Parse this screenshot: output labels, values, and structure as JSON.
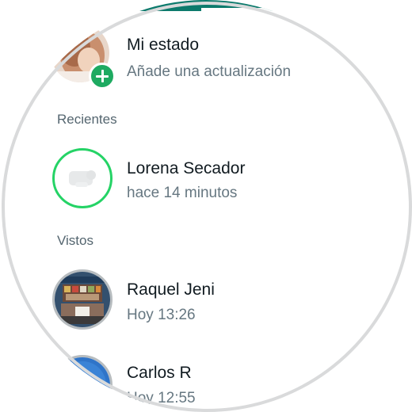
{
  "my_status": {
    "name": "Mi estado",
    "subtitle": "Añade una actualización",
    "avatar_icon": "profile-photo",
    "add_icon": "plus-icon"
  },
  "sections": {
    "recent": "Recientes",
    "viewed": "Vistos"
  },
  "recent_items": [
    {
      "name": "Lorena Secador",
      "time": "hace 14 minutos"
    }
  ],
  "viewed_items": [
    {
      "name": "Raquel Jeni",
      "time": "Hoy 13:26"
    },
    {
      "name": "Carlos R",
      "time": "Hoy 12:55"
    }
  ],
  "colors": {
    "accent_green": "#25d366",
    "header_teal": "#0c7a6c",
    "viewed_ring": "#b7bcbf",
    "secondary_text": "#667781"
  }
}
